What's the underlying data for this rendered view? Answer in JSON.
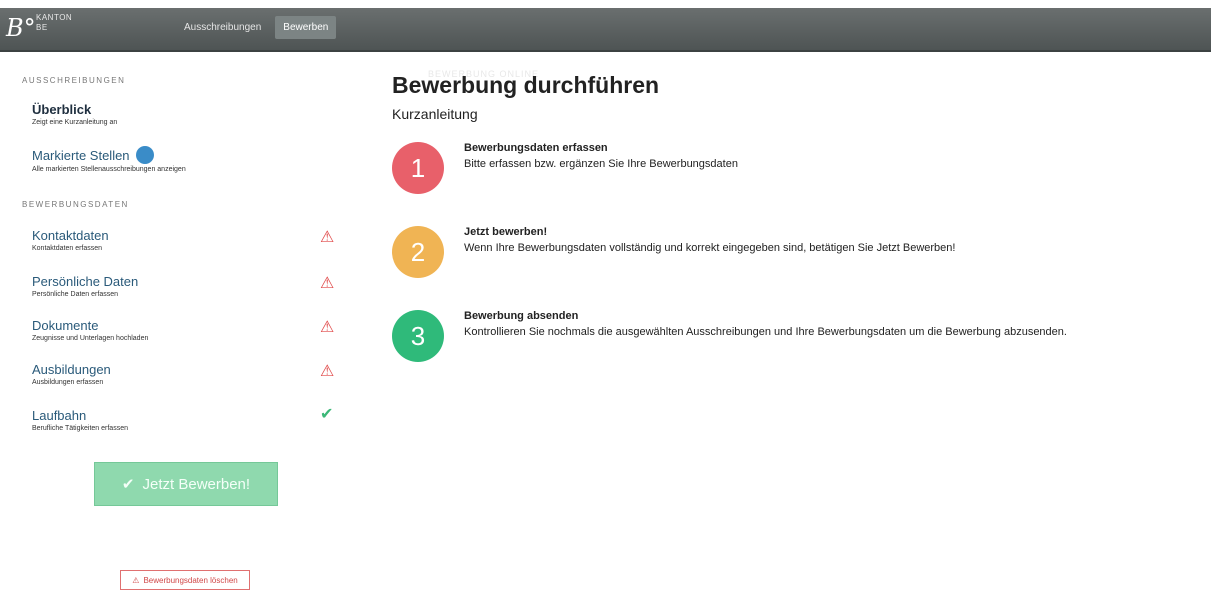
{
  "app": {
    "logo_mark": "B°",
    "logo_line1": "KANTON",
    "logo_line2": "BEWERBUNG ONLINE",
    "logo_line3": "BE",
    "nav": [
      {
        "label": "Ausschreibungen",
        "active": false
      },
      {
        "label": "Bewerben",
        "active": true
      }
    ]
  },
  "sidebar": {
    "section1_label": "AUSSCHREIBUNGEN",
    "overview": {
      "title": "Überblick",
      "sub": "Zeigt eine Kurzanleitung an"
    },
    "marked": {
      "title": "Markierte Stellen",
      "sub": "Alle markierten Stellenausschreibungen anzeigen"
    },
    "section2_label": "BEWERBUNGSDATEN",
    "items": [
      {
        "title": "Kontaktdaten",
        "sub": "Kontaktdaten erfassen",
        "status": "warning"
      },
      {
        "title": "Persönliche Daten",
        "sub": "Persönliche Daten erfassen",
        "status": "warning"
      },
      {
        "title": "Dokumente",
        "sub": "Zeugnisse und Unterlagen hochladen",
        "status": "warning"
      },
      {
        "title": "Ausbildungen",
        "sub": "Ausbildungen erfassen",
        "status": "warning"
      },
      {
        "title": "Laufbahn",
        "sub": "Berufliche Tätigkeiten erfassen",
        "status": "ok"
      }
    ],
    "apply_label": "Jetzt Bewerben!",
    "delete_label": "Bewerbungsdaten löschen",
    "status_glyphs": {
      "warning": "⚠",
      "ok": "✔"
    }
  },
  "main": {
    "title": "Bewerbung durchführen",
    "subtitle": "Kurzanleitung",
    "steps": [
      {
        "number": "1",
        "color": "#e8606a",
        "title": "Bewerbungsdaten erfassen",
        "desc": "Bitte erfassen bzw. ergänzen Sie Ihre Bewerbungsdaten"
      },
      {
        "number": "2",
        "color": "#f0b454",
        "title": "Jetzt bewerben!",
        "desc": "Wenn Ihre Bewerbungsdaten vollständig und korrekt eingegeben sind, betätigen Sie Jetzt Bewerben!"
      },
      {
        "number": "3",
        "color": "#2fba7a",
        "title": "Bewerbung absenden",
        "desc": "Kontrollieren Sie nochmals die ausgewählten Ausschreibungen und Ihre Bewerbungsdaten um die Bewerbung abzusenden."
      }
    ]
  }
}
